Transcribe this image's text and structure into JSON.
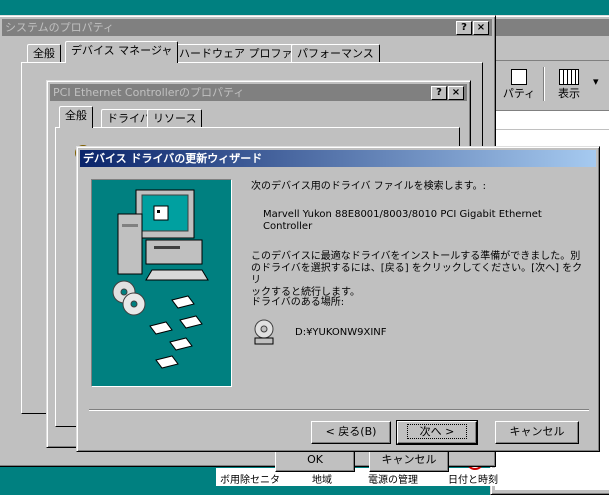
{
  "system_properties": {
    "title": "システムのプロパティ",
    "title_buttons": {
      "help": "?",
      "close": "×"
    },
    "tabs": [
      {
        "label": "全般"
      },
      {
        "label": "デバイス マネージャ"
      },
      {
        "label": "ハードウェア プロファイル"
      },
      {
        "label": "パフォーマンス"
      }
    ],
    "buttons": {
      "ok": "OK",
      "cancel": "キャンセル"
    }
  },
  "pci_properties": {
    "title": "PCI Ethernet Controllerのプロパティ",
    "title_buttons": {
      "help": "?",
      "close": "×"
    },
    "tabs": [
      {
        "label": "全般"
      },
      {
        "label": "ドライバ"
      },
      {
        "label": "リソース"
      }
    ]
  },
  "background_window": {
    "toolbar": {
      "properties_label": "パティ",
      "view_label": "表示",
      "dropdown": "▾"
    },
    "bottom_labels": [
      "ボ用除セニタ",
      "地域",
      "電源の管理",
      "日付と時刻"
    ]
  },
  "wizard": {
    "title": "デバイス ドライバの更新ウィザード",
    "search_text": "次のデバイス用のドライバ ファイルを検索します。:",
    "device_name": "Marvell Yukon 88E8001/8003/8010 PCI Gigabit Ethernet\nController",
    "ready_text": "このデバイスに最適なドライバをインストールする準備ができました。別\nのドライバを選択するには、[戻る] をクリックしてください。[次へ] をクリ\nックすると続行します。",
    "location_label": "ドライバのある場所:",
    "driver_path": "D:¥YUKONW9XINF",
    "buttons": {
      "back": "< 戻る(B)",
      "next": "次へ >",
      "cancel": "キャンセル"
    }
  }
}
